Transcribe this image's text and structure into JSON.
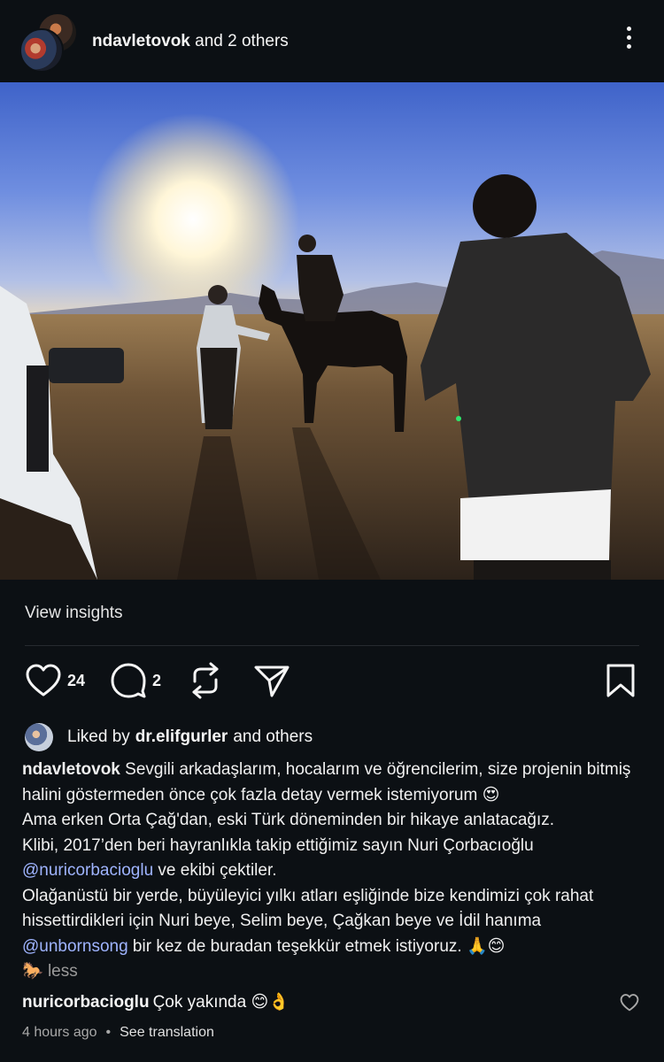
{
  "header": {
    "owner_username": "ndavletovok",
    "owner_suffix": " and 2 others",
    "avatar_icon": "collab-avatars",
    "menu_icon": "more-vertical-icon"
  },
  "post": {
    "image_description_icon": "photo"
  },
  "insights": {
    "label": "View insights"
  },
  "actions": {
    "like_count": "24",
    "comment_count": "2",
    "like_icon": "heart-icon",
    "comment_icon": "comment-icon",
    "repost_icon": "repost-icon",
    "share_icon": "send-icon",
    "save_icon": "bookmark-icon"
  },
  "liked_by": {
    "prefix": "Liked by",
    "user": "dr.elifgurler",
    "suffix": "and others"
  },
  "caption": {
    "username": "ndavletovok",
    "line1": " Sevgili arkadaşlarım, hocalarım ve öğrencilerim, size projenin bitmiş halini göstermeden önce çok fazla detay vermek istemiyorum 😍",
    "line2": "Ama erken Orta Çağ'dan, eski Türk döneminden bir hikaye anlatacağız.",
    "line3": "Klibi, 2017’den beri hayranlıkla takip ettiğimiz sayın Nuri Çorbacıoğlu",
    "mention1": "@nuricorbacioglu",
    "line4_after": " ve ekibi çektiler.",
    "line5": "Olağanüstü bir yerde, büyüleyici yılkı atları eşliğinde bize kendimizi çok rahat hissettirdikleri için Nuri beye, Selim beye, Çağkan beye ve İdil hanıma ",
    "mention2": "@unbornsong",
    "line6_after": " bir kez de buradan teşekkür etmek istiyoruz. 🙏😊",
    "emoji_end": "🐎",
    "less": " less"
  },
  "comment": {
    "username": "nuricorbacioglu",
    "text": "Çok yakında 😊👌"
  },
  "meta": {
    "time": "4 hours ago",
    "separator": "•",
    "translate": "See translation"
  }
}
